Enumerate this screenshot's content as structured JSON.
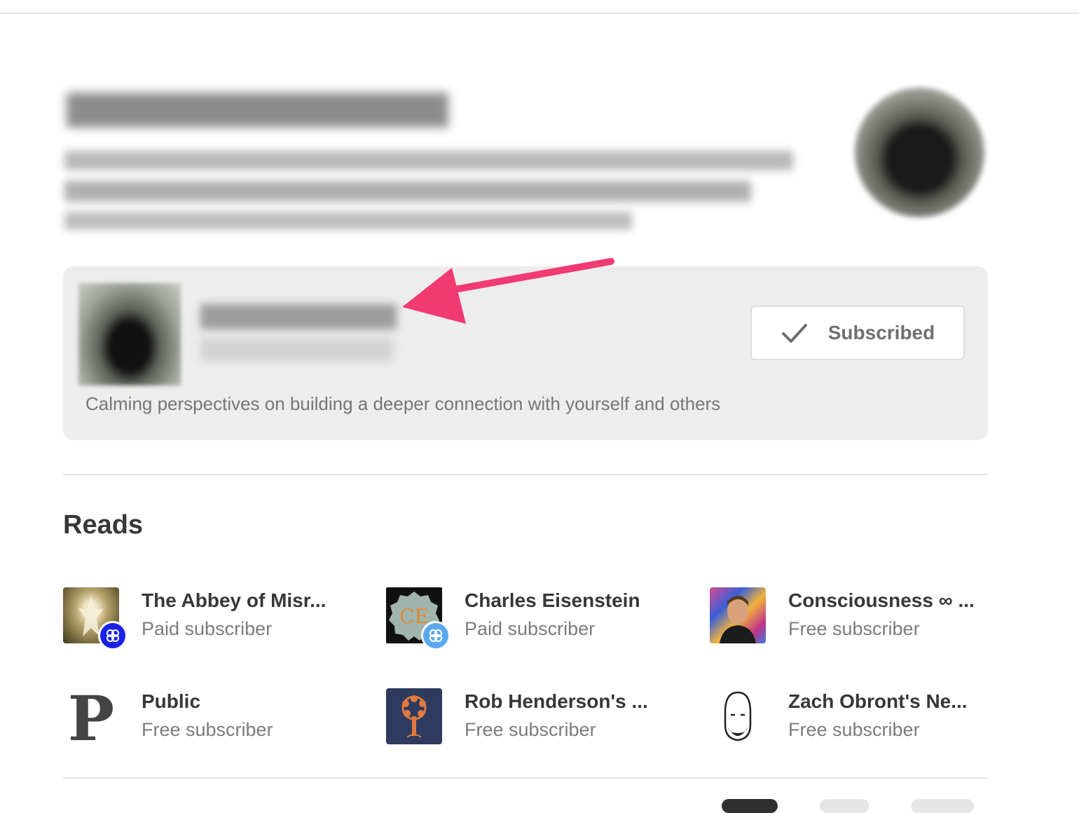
{
  "publication": {
    "subscribe_button": {
      "label": "Subscribed",
      "icon": "check-icon"
    },
    "description": "Calming perspectives on building a deeper connection with yourself and others"
  },
  "reads": {
    "title": "Reads",
    "items": [
      {
        "name": "The Abbey of Misr...",
        "status": "Paid subscriber"
      },
      {
        "name": "Charles Eisenstein",
        "status": "Paid subscriber",
        "logo_text": "CE"
      },
      {
        "name": "Consciousness ∞ ...",
        "status": "Free subscriber"
      },
      {
        "name": "Public",
        "status": "Free subscriber",
        "logo_text": "P"
      },
      {
        "name": "Rob Henderson's ...",
        "status": "Free subscriber"
      },
      {
        "name": "Zach Obront's Ne...",
        "status": "Free subscriber"
      }
    ]
  },
  "colors": {
    "annotation_arrow": "#f23a73",
    "badge_dark": "#1a22e6",
    "badge_light": "#5aa9ee"
  }
}
